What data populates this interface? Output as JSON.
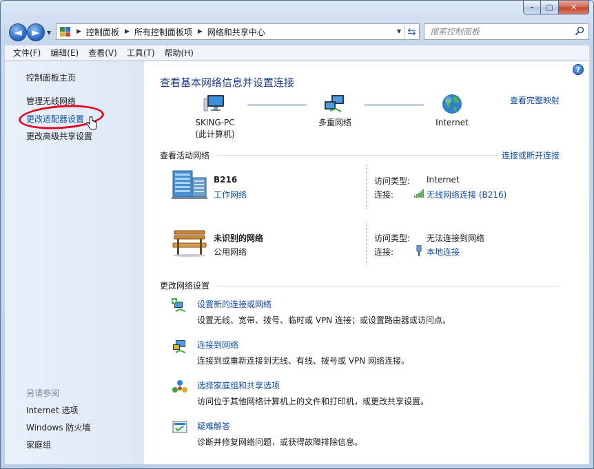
{
  "window": {
    "caption_min": "–",
    "caption_max": "□",
    "caption_close": "✕"
  },
  "nav": {
    "back_glyph": "◄",
    "forward_glyph": "►",
    "breadcrumbs": [
      "控制面板",
      "所有控制面板项",
      "网络和共享中心"
    ],
    "search_placeholder": "搜索控制面板"
  },
  "menu": [
    "文件(F)",
    "编辑(E)",
    "查看(V)",
    "工具(T)",
    "帮助(H)"
  ],
  "sidebar": {
    "home": "控制面板主页",
    "items": [
      "管理无线网络",
      "更改适配器设置",
      "更改高级共享设置"
    ],
    "see_also_header": "另请参阅",
    "see_also": [
      "Internet 选项",
      "Windows 防火墙",
      "家庭组"
    ]
  },
  "main": {
    "title": "查看基本网络信息并设置连接",
    "full_map_link": "查看完整映射",
    "nodes": [
      {
        "line1": "SKING-PC",
        "line2": "(此计算机)",
        "icon": "computer-icon"
      },
      {
        "line1": "多重网络",
        "line2": "",
        "icon": "multiple-networks-icon"
      },
      {
        "line1": "Internet",
        "line2": "",
        "icon": "globe-icon"
      }
    ],
    "active_networks_title": "查看活动网络",
    "connect_disconnect_link": "连接或断开连接",
    "networks": [
      {
        "name": "B216",
        "type": "工作网络",
        "access_label": "访问类型:",
        "access_value": "Internet",
        "conn_label": "连接:",
        "conn_value": "无线网络连接 (B216)",
        "icon": "office-building-icon",
        "conn_icon": "wifi-signal-icon"
      },
      {
        "name": "未识别的网络",
        "type": "公用网络",
        "access_label": "访问类型:",
        "access_value": "无法连接到网络",
        "conn_label": "连接:",
        "conn_value": "本地连接",
        "icon": "park-bench-icon",
        "conn_icon": "ethernet-plug-icon"
      }
    ],
    "change_settings_title": "更改网络设置",
    "tasks": [
      {
        "link": "设置新的连接或网络",
        "desc": "设置无线、宽带、拨号、临时或 VPN 连接；或设置路由器或访问点。",
        "icon": "new-connection-icon"
      },
      {
        "link": "连接到网络",
        "desc": "连接到或重新连接到无线、有线、拨号或 VPN 网络连接。",
        "icon": "connect-network-icon"
      },
      {
        "link": "选择家庭组和共享选项",
        "desc": "访问位于其他网络计算机上的文件和打印机，或更改共享设置。",
        "icon": "homegroup-icon"
      },
      {
        "link": "疑难解答",
        "desc": "诊断并修复网络问题，或获得故障排除信息。",
        "icon": "troubleshoot-icon"
      }
    ]
  },
  "colors": {
    "link": "#0f4da6",
    "title": "#1f3c88",
    "annotation": "#e3001f"
  }
}
